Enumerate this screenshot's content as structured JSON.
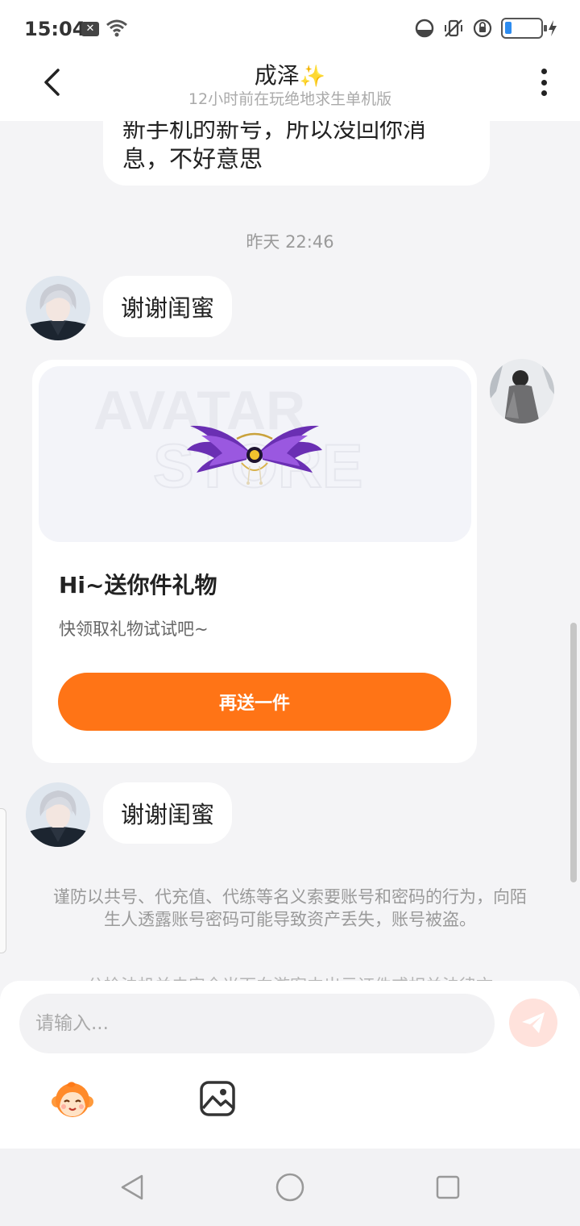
{
  "status": {
    "time": "15:04",
    "x_badge": "✕",
    "battery_level": 0.2
  },
  "header": {
    "title": "成泽",
    "title_emoji": "✨",
    "subtitle": "12小时前在玩绝地求生单机版"
  },
  "messages": {
    "top_bubble_text": "新手机的新号，所以没回你消息，不好意思",
    "timestamp": "昨天 22:46",
    "thanks_1": "谢谢闺蜜",
    "thanks_2": "谢谢闺蜜"
  },
  "gift_card": {
    "watermark_1": "AVATAR",
    "watermark_2": "STORE",
    "title": "Hi~送你件礼物",
    "subtitle": "快领取礼物试试吧~",
    "button_label": "再送一件"
  },
  "notice": {
    "text": "谨防以共号、代充值、代练等名义索要账号和密码的行为，向陌生人透露账号密码可能导致资产丢失，账号被盗。",
    "text_2": "公检法机关未安全当面向游客中出示证件或相关法律文"
  },
  "input": {
    "placeholder": "请输入..."
  },
  "colors": {
    "accent": "#ff7416",
    "send_disabled": "#ffe2dc",
    "background": "#f4f4f6"
  },
  "icons": {
    "back": "chevron-left-icon",
    "more": "more-vertical-icon",
    "send": "paper-plane-icon",
    "emoji": "monkey-emoji-icon",
    "image": "image-icon"
  }
}
